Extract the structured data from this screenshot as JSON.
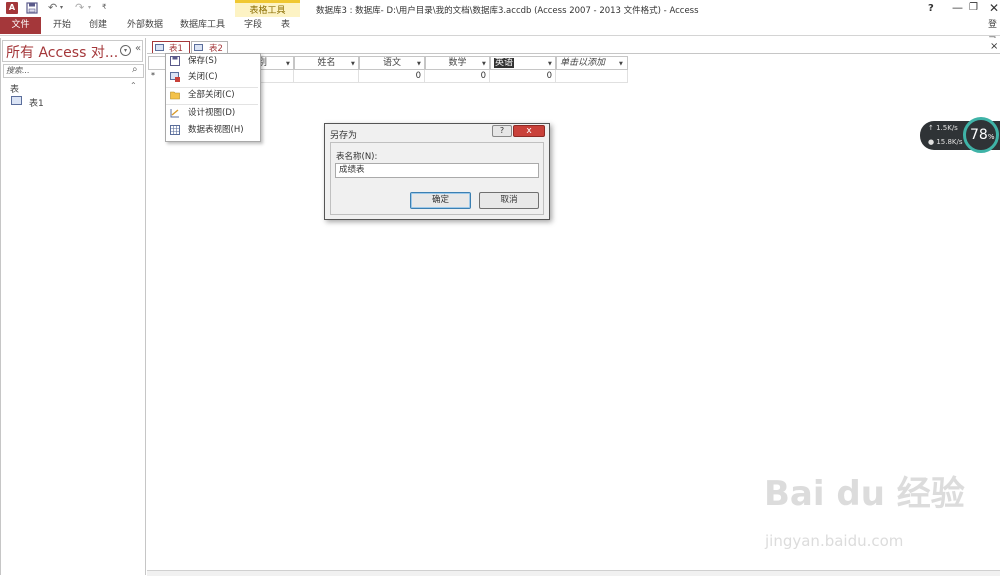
{
  "title_bar": {
    "app_icon": "A",
    "window_title": "数据库3 : 数据库- D:\\用户目录\\我的文档\\数据库3.accdb (Access 2007 - 2013 文件格式) - Access",
    "help": "?",
    "minimize": "—",
    "restore": "❐",
    "close": "✕"
  },
  "qat": {
    "undo": "↶",
    "redo": "↷",
    "dropdown": "▾",
    "customize": "₹"
  },
  "ribbon": {
    "file_tab": "文件",
    "tabs": [
      "开始",
      "创建",
      "外部数据",
      "数据库工具",
      "字段",
      "表"
    ],
    "context_group": "表格工具",
    "signin": "登录"
  },
  "nav_pane": {
    "title": "所有 Access 对...",
    "dropdown": "▾",
    "collapse": "«",
    "search_placeholder": "搜索...",
    "search_icon": "⌕",
    "group": "表",
    "group_toggle": "⌃",
    "items": [
      {
        "label": "表1"
      }
    ]
  },
  "doc_tabs": [
    {
      "label": "表1",
      "active": true
    },
    {
      "label": "表2",
      "active": false
    }
  ],
  "doc_close": "×",
  "grid": {
    "columns": [
      "别",
      "姓名",
      "语文",
      "数学",
      "英语",
      "单击以添加"
    ],
    "new_row": [
      "0",
      "0",
      "0"
    ],
    "new_row_marker": "*"
  },
  "context_menu": {
    "items": [
      "保存(S)",
      "关闭(C)",
      "全部关闭(C)",
      "设计视图(D)",
      "数据表视图(H)"
    ]
  },
  "dialog": {
    "title": "另存为",
    "help": "?",
    "close": "x",
    "field_label": "表名称(N):",
    "value": "成绩表",
    "ok": "确定",
    "cancel": "取消"
  },
  "net_monitor": {
    "up": "↑ 1.5K/s",
    "down": "● 15.8K/s",
    "percent": "78",
    "percent_unit": "%"
  },
  "watermark": {
    "main": "Bai du 经验",
    "sub": "jingyan.baidu.com"
  },
  "colors": {
    "access_red": "#a4373a",
    "context_tab": "#fdf3c4",
    "dialog_close": "#c9413a",
    "net_ring": "#3fb3a7"
  }
}
